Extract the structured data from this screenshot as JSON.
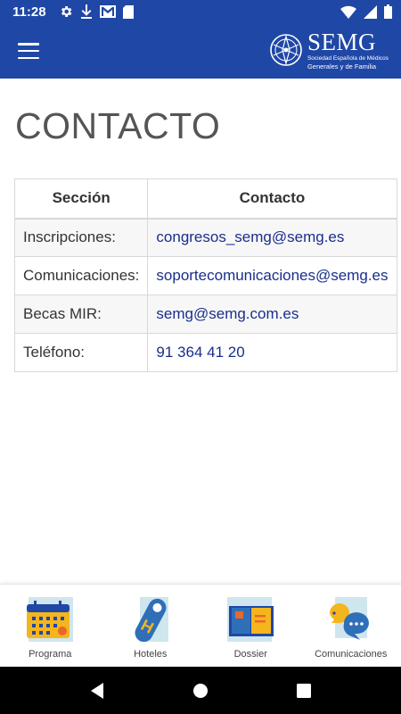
{
  "status_bar": {
    "time": "11:28",
    "icons_left": [
      "settings-gear",
      "download-arrow",
      "gmail-m",
      "sd-card"
    ],
    "icons_right": [
      "wifi",
      "signal",
      "battery"
    ]
  },
  "app_bar": {
    "brand_name": "SEMG",
    "brand_sub_1": "Sociedad Española de Médicos",
    "brand_sub_2": "Generales y de Familia",
    "accent_color": "#1f47a6"
  },
  "page": {
    "title": "CONTACTO"
  },
  "table": {
    "headers": [
      "Sección",
      "Contacto"
    ],
    "rows": [
      {
        "section": "Inscripciones:",
        "contact": "congresos_semg@semg.es"
      },
      {
        "section": "Comunicaciones:",
        "contact": "soportecomunicaciones@semg.es"
      },
      {
        "section": "Becas MIR:",
        "contact": "semg@semg.com.es"
      },
      {
        "section": "Teléfono:",
        "contact": "91 364 41 20"
      }
    ],
    "link_color": "#1a2e8c"
  },
  "bottom_nav": {
    "items": [
      {
        "label": "Programa",
        "icon": "calendar-icon"
      },
      {
        "label": "Hoteles",
        "icon": "hotel-tag-icon"
      },
      {
        "label": "Dossier",
        "icon": "book-icon"
      },
      {
        "label": "Comunicaciones",
        "icon": "chat-bubbles-icon"
      }
    ]
  }
}
